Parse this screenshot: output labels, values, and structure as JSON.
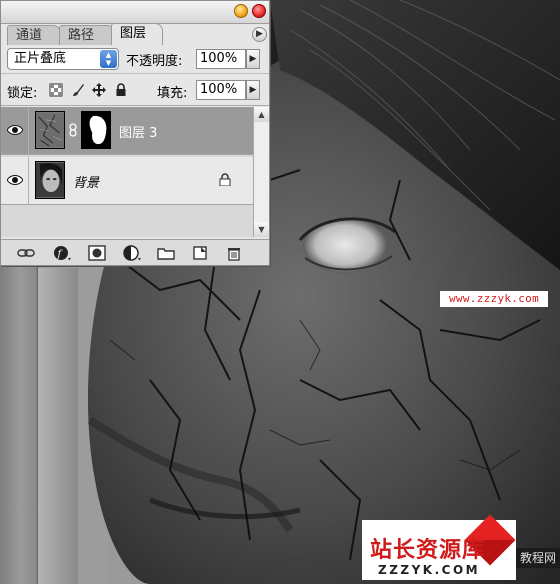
{
  "panel": {
    "tabs": [
      {
        "label": "通道",
        "active": false
      },
      {
        "label": "路径",
        "active": false
      },
      {
        "label": "图层",
        "active": true
      }
    ],
    "blend_mode": "正片叠底",
    "opacity_label": "不透明度:",
    "opacity_value": "100%",
    "lock_label": "锁定:",
    "fill_label": "填充:",
    "fill_value": "100%",
    "layers": [
      {
        "name": "图层 3",
        "selected": true,
        "visible": true,
        "has_mask": true
      },
      {
        "name": "背景",
        "selected": false,
        "visible": true,
        "locked": true
      }
    ],
    "bottom_icons": [
      "link-layers-icon",
      "layer-style-icon",
      "add-mask-icon",
      "adjustment-layer-icon",
      "new-group-icon",
      "new-layer-icon",
      "trash-icon"
    ]
  },
  "watermarks": {
    "small_url": "www.zzzyk.com",
    "logo_name": "站长资源库",
    "logo_domain": "ZZZYK.COM",
    "corner_tag": "教程网"
  },
  "colors": {
    "selection": "#9a9a9a",
    "watermark_red": "#d01e1e",
    "close_button": "#e52a2a",
    "minimize_button": "#f0a51d",
    "blend_arrows": "#2f6fc8"
  }
}
